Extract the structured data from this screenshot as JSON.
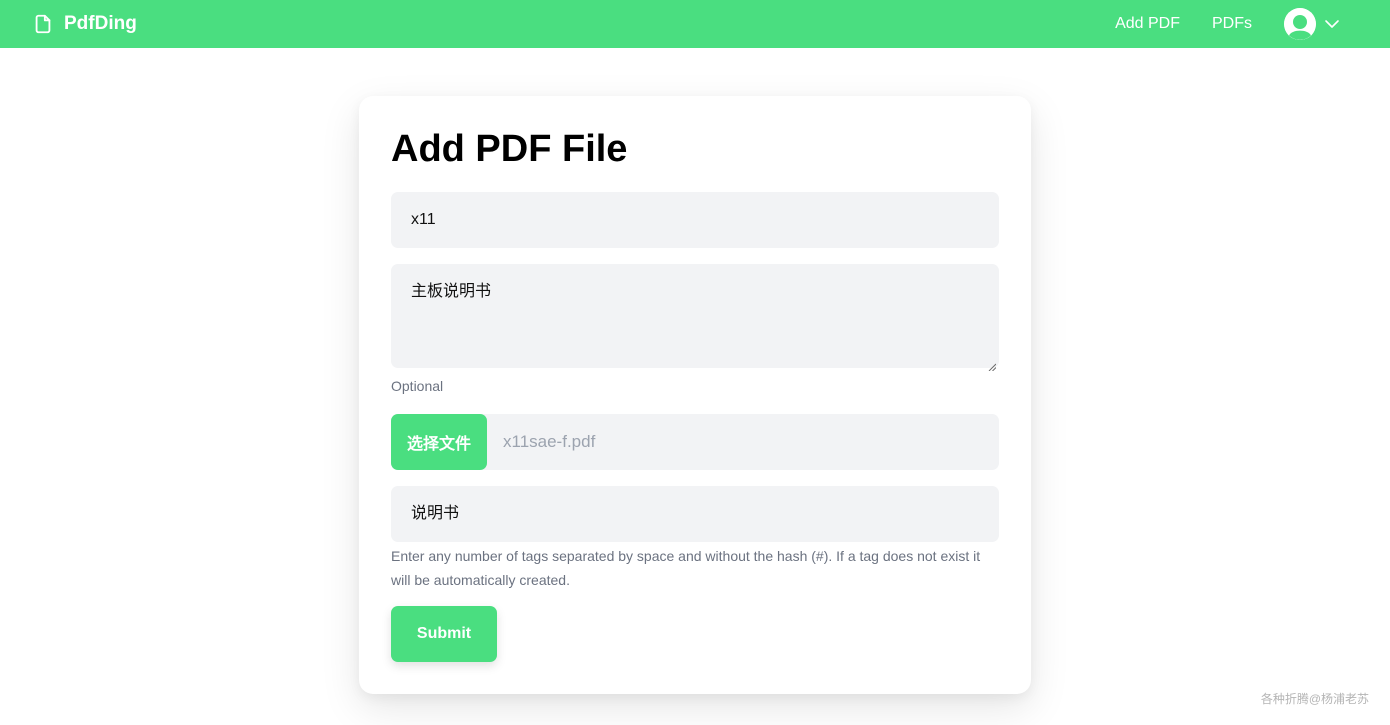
{
  "navbar": {
    "brand_name": "PdfDing",
    "brand_icon": "document-icon",
    "links": [
      "Add PDF",
      "PDFs"
    ],
    "avatar_icon": "user-avatar-icon",
    "dropdown_icon": "chevron-down-icon"
  },
  "form": {
    "title": "Add PDF File",
    "name_value": "x11",
    "description_value": "主板说明书",
    "description_hint": "Optional",
    "file_button_label": "选择文件",
    "file_name": "x11sae-f.pdf",
    "tags_value": "说明书",
    "tags_hint": "Enter any number of tags separated by space and without the hash (#). If a tag does not exist it will be automatically created.",
    "submit_label": "Submit"
  },
  "watermark": "各种折腾@杨浦老苏",
  "colors": {
    "accent": "#4ade80",
    "field_bg": "#f2f3f5",
    "hint_text": "#6b7280"
  }
}
